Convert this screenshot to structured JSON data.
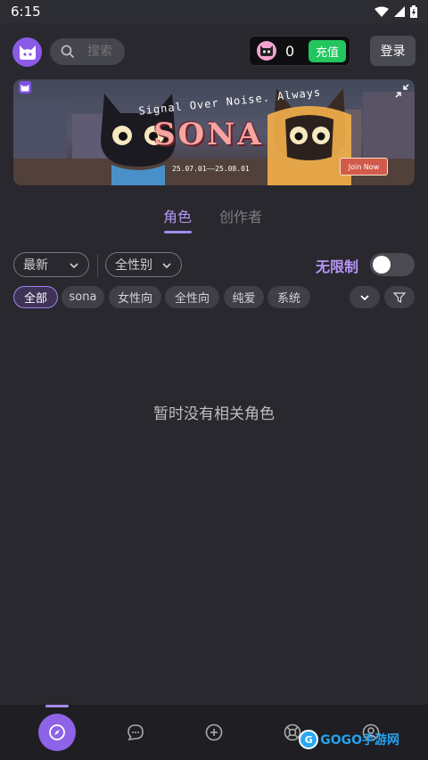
{
  "status_bar": {
    "time": "6:15"
  },
  "header": {
    "search_placeholder": "搜索",
    "coin_count": "0",
    "recharge_label": "充值",
    "login_label": "登录"
  },
  "banner": {
    "tagline": "Signal Over Noise. Always",
    "title": "SONA",
    "dates": "25.07.01——25.08.01",
    "join_label": "Join Now"
  },
  "tabs": [
    {
      "label": "角色",
      "active": true
    },
    {
      "label": "创作者",
      "active": false
    }
  ],
  "filters": {
    "sort": "最新",
    "gender": "全性别",
    "unlimited_label": "无限制",
    "unlimited_enabled": false
  },
  "chips": [
    {
      "label": "全部",
      "active": true
    },
    {
      "label": "sona",
      "active": false
    },
    {
      "label": "女性向",
      "active": false
    },
    {
      "label": "全性向",
      "active": false
    },
    {
      "label": "纯爱",
      "active": false
    },
    {
      "label": "系统",
      "active": false
    }
  ],
  "empty_message": "暂时没有相关角色",
  "bottom_nav": [
    {
      "icon": "compass-icon",
      "active": true
    },
    {
      "icon": "chat-bubble-icon",
      "active": false
    },
    {
      "icon": "plus-circle-icon",
      "active": false
    },
    {
      "icon": "lifebuoy-icon",
      "active": false
    },
    {
      "icon": "user-icon",
      "active": false
    }
  ],
  "watermark": {
    "text": "GOGO手游网"
  },
  "colors": {
    "background": "#28282e",
    "accent": "#8e63e8",
    "recharge": "#22c55e",
    "tab_active": "#b096f0"
  }
}
